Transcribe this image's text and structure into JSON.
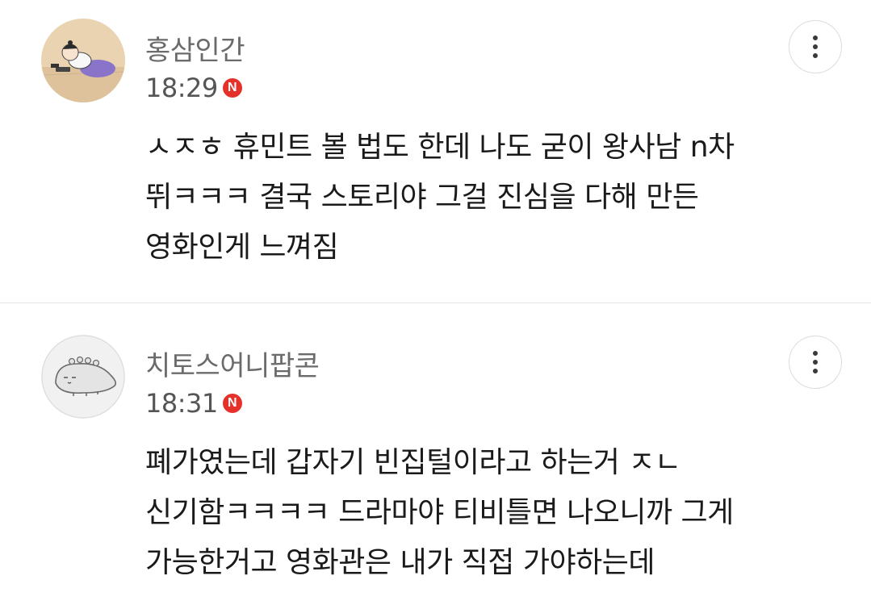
{
  "comments": [
    {
      "username": "홍삼인간",
      "time": "18:29",
      "badge": "N",
      "lines": [
        "ㅅㅈㅎ 휴민트 볼 법도 한데 나도 굳이 왕사남 n차",
        "뛰ㅋㅋㅋ 결국 스토리야 그걸 진심을 다해 만든",
        "영화인게 느껴짐"
      ]
    },
    {
      "username": "치토스어니팝콘",
      "time": "18:31",
      "badge": "N",
      "lines": [
        "폐가였는데 갑자기 빈집털이라고 하는거 ㅈㄴ",
        "신기함ㅋㅋㅋㅋ 드라마야 티비틀면 나오니까 그게",
        "가능한거고 영화관은 내가 직접 가야하는데"
      ]
    }
  ],
  "colors": {
    "badge": "#e5312a",
    "username": "#6b6b6b",
    "body": "#1a1a1a",
    "divider": "#e6e6e6"
  },
  "icons": {
    "more": "more-vertical-icon",
    "badge": "new-badge-icon"
  }
}
